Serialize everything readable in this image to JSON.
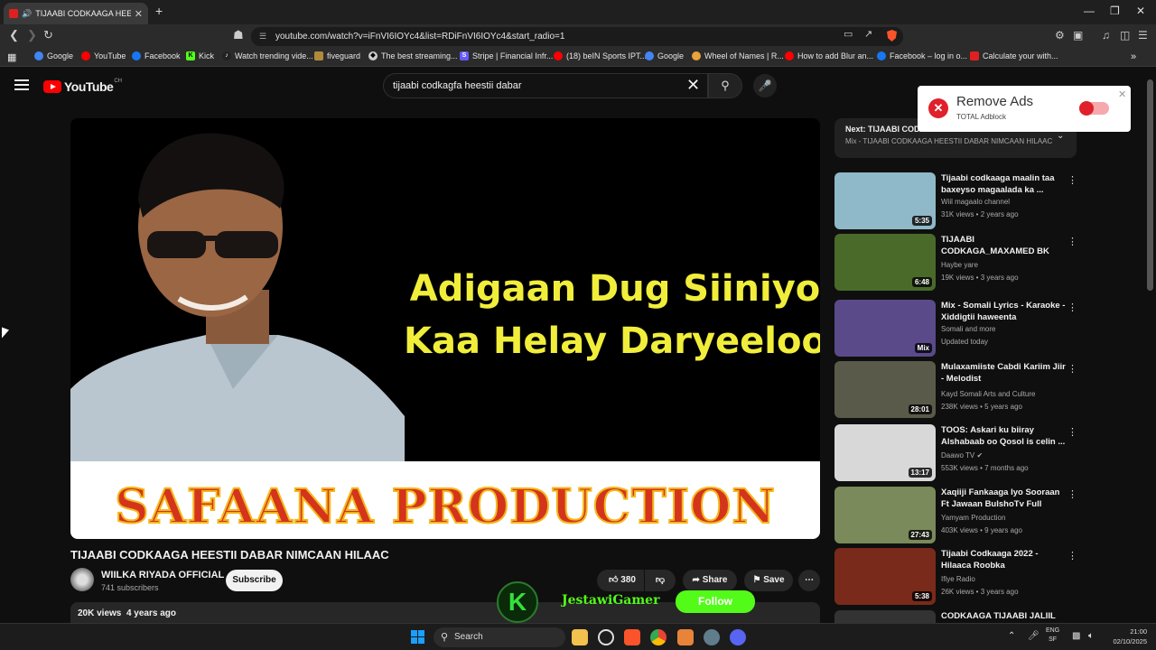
{
  "browser": {
    "tab_title": "TIJAABI CODKAAGA HEESTII D",
    "url": "youtube.com/watch?v=iFnVI6IOYc4&list=RDiFnVI6IOYc4&start_radio=1",
    "bookmarks": [
      {
        "label": "Google",
        "icon": "google-icon",
        "color": "#4285f4"
      },
      {
        "label": "YouTube",
        "icon": "youtube-icon",
        "color": "#ff0000"
      },
      {
        "label": "Facebook",
        "icon": "facebook-icon",
        "color": "#1877f2"
      },
      {
        "label": "Kick",
        "icon": "kick-icon",
        "color": "#53fc18"
      },
      {
        "label": "Watch trending vide...",
        "icon": "tiktok-icon",
        "color": "#222222"
      },
      {
        "label": "fiveguard",
        "icon": "fiveguard-icon",
        "color": "#b08a3a"
      },
      {
        "label": "The best streaming...",
        "icon": "streaming-icon",
        "color": "#cccccc"
      },
      {
        "label": "Stripe | Financial Infr...",
        "icon": "stripe-icon",
        "color": "#635bff"
      },
      {
        "label": "(18) beIN Sports IPT...",
        "icon": "youtube-icon",
        "color": "#ff0000"
      },
      {
        "label": "Google",
        "icon": "google-icon",
        "color": "#4285f4"
      },
      {
        "label": "Wheel of Names | R...",
        "icon": "wheel-icon",
        "color": "#e8a33a"
      },
      {
        "label": "How to add Blur an...",
        "icon": "youtube-icon",
        "color": "#ff0000"
      },
      {
        "label": "Facebook – log in o...",
        "icon": "facebook-icon",
        "color": "#1877f2"
      },
      {
        "label": "Calculate your with...",
        "icon": "calc-icon",
        "color": "#e02020"
      }
    ]
  },
  "youtube": {
    "logo_text": "YouTube",
    "region": "CH",
    "search_query": "tijaabi codkagfa heestii dabar",
    "video": {
      "headline_1": "Adigaan Dug Siiniyo",
      "headline_2": "Kaa Helay Daryeeloo",
      "banner": "SAFAANA PRODUCTION",
      "title": "TIJAABI CODKAAGA HEESTII DABAR NIMCAAN HILAAC",
      "channel": "WIILKA RIYADA OFFICIAL",
      "subscribers": "741 subscribers",
      "subscribe_label": "Subscribe",
      "likes": "380",
      "share_label": "Share",
      "save_label": "Save",
      "views": "20K views",
      "age": "4 years ago"
    },
    "overlay": {
      "streamer": "JestawiGamer",
      "follow_label": "Follow"
    },
    "up_next": {
      "label": "Next:",
      "title": "TIJAABI CODKAAGA HEESTII DABAR NIM...",
      "playlist": "Mix - TIJAABI CODKAAGA HEESTII DABAR NIMCAAN HILAAC"
    },
    "recommendations": [
      {
        "title": "Tijaabi codkaaga maalin taa baxeyso magaalada ka ...",
        "channel": "Wiil magaalo channel",
        "meta": "31K views • 2 years ago",
        "duration": "5:35",
        "thumb": "#8fb8c8"
      },
      {
        "title": "TIJAABI CODKAGA_MAXAMED BK",
        "channel": "Haybe yare",
        "meta": "19K views • 3 years ago",
        "duration": "6:48",
        "thumb": "#4a6a2a"
      },
      {
        "title": "Mix - Somali Lyrics -  Karaoke  - Xiddigtii haweenta",
        "channel": "Somali and more",
        "meta": "Updated today",
        "duration": "Mix",
        "thumb": "#5a4a8a"
      },
      {
        "title": "Mulaxamiiste Cabdi Kariim Jiir - Melodist",
        "channel": "Kayd Somali Arts and Culture",
        "meta": "238K views • 5 years ago",
        "duration": "28:01",
        "thumb": "#5a5a4a"
      },
      {
        "title": "TOOS: Askari ku biiray Alshabaab oo Qosol is celin ...",
        "channel": "Daawo TV",
        "meta": "553K views • 7 months ago",
        "duration": "13:17",
        "thumb": "#d8d8d8"
      },
      {
        "title": "Xaqiiji Fankaaga Iyo Sooraan Ft Jawaan BulshoTv Full",
        "channel": "Yamyam Production",
        "meta": "403K views • 9 years ago",
        "duration": "27:43",
        "thumb": "#7a8a5a"
      },
      {
        "title": "Tijaabi Codkaaga 2022 -Hilaaca Roobka",
        "channel": "Ifiye Radio",
        "meta": "26K views • 3 years ago",
        "duration": "5:38",
        "thumb": "#7a2a1a"
      },
      {
        "title": "CODKAAGA TIJAABI JALIIL",
        "channel": "",
        "meta": "",
        "duration": "",
        "thumb": "#333333"
      }
    ]
  },
  "adblock": {
    "title": "Remove Ads",
    "brand": "TOTAL Adblock"
  },
  "taskbar": {
    "search_label": "Search",
    "lang_1": "ENG",
    "lang_2": "SF",
    "time": "21:00",
    "date": "02/10/2025"
  }
}
